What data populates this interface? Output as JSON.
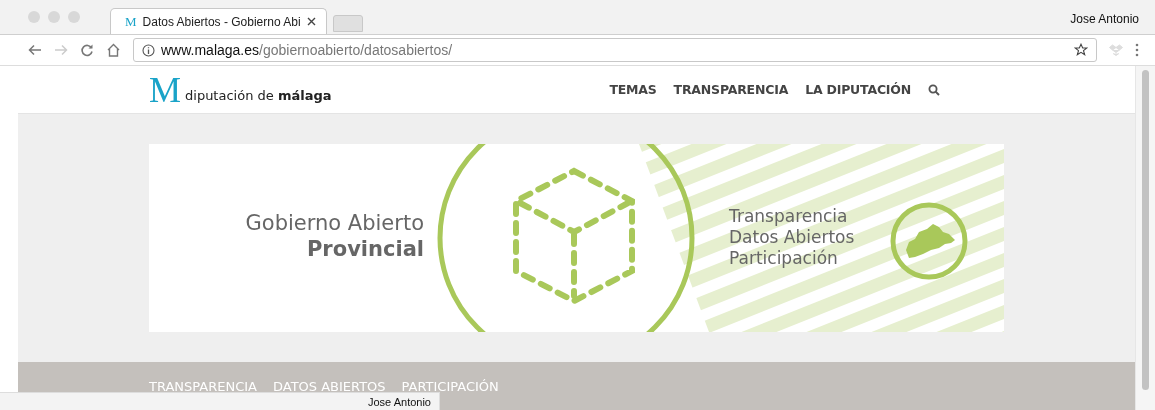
{
  "browser": {
    "tabs": [
      {
        "title": "Datos Abiertos - Gobierno Abi",
        "selected": true
      }
    ],
    "profile": "Jose Antonio",
    "url": {
      "host": "www.malaga.es",
      "path": "/gobiernoabierto/datosabiertos/"
    }
  },
  "favicon_letter": "M",
  "site": {
    "logo": {
      "letter": "M",
      "text": "diputación de **málaga**"
    },
    "nav": [
      {
        "label": "TEMAS"
      },
      {
        "label": "TRANSPARENCIA"
      },
      {
        "label": "LA DIPUTACIÓN"
      }
    ]
  },
  "banner": {
    "title_line_1": "Gobierno Abierto",
    "title_line_2": "Provincial",
    "items": [
      "Transparencia",
      "Datos Abiertos",
      "Participación"
    ]
  },
  "subnav": [
    {
      "label": "TRANSPARENCIA"
    },
    {
      "label": "DATOS ABIERTOS"
    },
    {
      "label": "PARTICIPACIÓN"
    }
  ],
  "status_bubble": "Jose Antonio"
}
